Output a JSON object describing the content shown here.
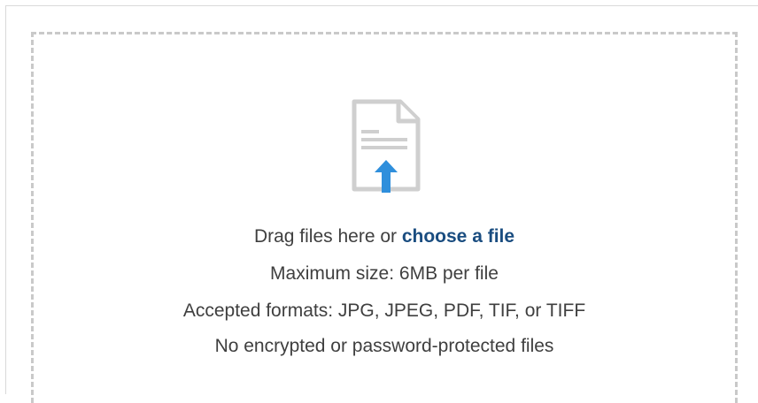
{
  "upload": {
    "drag_prefix": "Drag files here or ",
    "choose_link": "choose a file",
    "max_size": "Maximum size: 6MB per file",
    "formats": "Accepted formats: JPG, JPEG, PDF, TIF, or TIFF",
    "restriction": "No encrypted or password-protected files"
  },
  "icons": {
    "file_upload": "document-upload-icon"
  },
  "colors": {
    "link": "#1a4d80",
    "arrow": "#2f8fdc",
    "border": "#c9c9c9",
    "text": "#3f3f3f"
  }
}
